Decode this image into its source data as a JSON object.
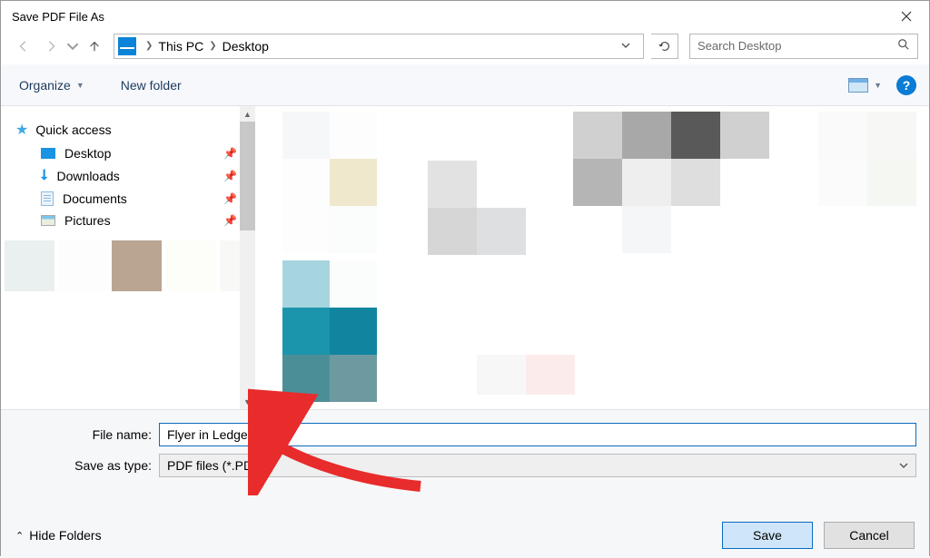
{
  "window": {
    "title": "Save PDF File As"
  },
  "address": {
    "crumb1": "This PC",
    "crumb2": "Desktop"
  },
  "search": {
    "placeholder": "Search Desktop"
  },
  "commands": {
    "organize": "Organize",
    "newfolder": "New folder"
  },
  "sidebar": {
    "quickaccess": "Quick access",
    "items": [
      {
        "label": "Desktop"
      },
      {
        "label": "Downloads"
      },
      {
        "label": "Documents"
      },
      {
        "label": "Pictures"
      }
    ]
  },
  "form": {
    "filename_label": "File name:",
    "filename_value": "Flyer in Ledger",
    "type_label": "Save as type:",
    "type_value": "PDF files (*.PDF)"
  },
  "footer": {
    "hidefolders": "Hide Folders",
    "save": "Save",
    "cancel": "Cancel"
  }
}
